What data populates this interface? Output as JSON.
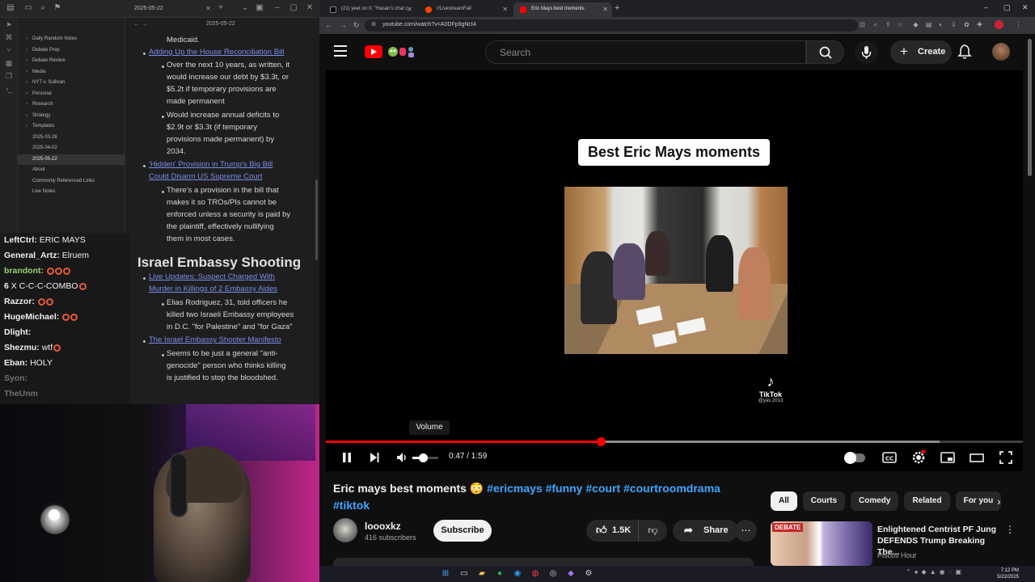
{
  "notes_app": {
    "tab_title": "2025-05-22",
    "note_title": "2025-05-22",
    "file_tree": [
      {
        "label": "Daily Random Notes",
        "folder": true
      },
      {
        "label": "Debate Prep",
        "folder": true
      },
      {
        "label": "Debate Review",
        "folder": true
      },
      {
        "label": "Media",
        "folder": true
      },
      {
        "label": "NYT v. Sullivan",
        "folder": true
      },
      {
        "label": "Personal",
        "folder": true
      },
      {
        "label": "Research",
        "folder": true
      },
      {
        "label": "Strategy",
        "folder": true
      },
      {
        "label": "Templates",
        "folder": true
      },
      {
        "label": "2025-03-26",
        "folder": false
      },
      {
        "label": "2025-04-02",
        "folder": false
      },
      {
        "label": "2025-05-22",
        "folder": false,
        "active": true
      },
      {
        "label": "About",
        "folder": false
      },
      {
        "label": "Commonly Referenced Links",
        "folder": false
      },
      {
        "label": "Live Notes",
        "folder": false
      }
    ],
    "body": {
      "medicaid": "Medicaid.",
      "link1": "Adding Up the House Reconciliation Bill",
      "b1": [
        "Over the next 10 years, as written, it",
        "would increase our debt by $3.3t, or",
        "$5.2t if temporary provisions are",
        "made permanent"
      ],
      "b2": [
        "Would increase annual deficits to",
        "$2.9t or $3.3t (if temporary",
        "provisions made permanent) by",
        "2034."
      ],
      "link2": [
        "'Hidden' Provision in Trump's Big Bill",
        "Could Disarm US Supreme Court"
      ],
      "b3": [
        "There's a provision in the bill that",
        "makes it so TROs/PIs cannot be",
        "enforced unless a security is paid by",
        "the plaintiff, effectively nullifying",
        "them in most cases."
      ],
      "heading": "Israel Embassy Shooting",
      "link3": [
        "Live Updates: Suspect Charged With",
        "Murder in Killings of 2 Embassy Aides"
      ],
      "b4": [
        "Elias Rodriguez, 31, told officers he",
        "killed two Israeli Embassy employees",
        "in D.C. \"for Palestine\" and \"for Gaza\""
      ],
      "link4": "The Israel Embassy Shooter Manifesto",
      "b5": [
        "Seems to be just a general \"anti-",
        "genocide\" person who thinks killing",
        "is justified to stop the bloodshed."
      ]
    }
  },
  "chat": [
    {
      "user": "LeftCtrl:",
      "msg": "ERIC MAYS",
      "color": "#f0f0f0"
    },
    {
      "user": "General_Artz:",
      "msg": "Elruem",
      "color": "#f0f0f0"
    },
    {
      "user": "brandont:",
      "msg": "",
      "color": "#9ad16a",
      "emotes": 3
    },
    {
      "user": "6",
      "msg": "X C-C-C-COMBO",
      "color": "#f0f0f0",
      "emotes": 1
    },
    {
      "user": "Razzor:",
      "msg": "",
      "color": "#f0f0f0",
      "emotes": 2
    },
    {
      "user": "HugeMichael:",
      "msg": "",
      "color": "#f0f0f0",
      "emotes": 2
    },
    {
      "user": "Dlight:",
      "msg": "",
      "color": "#f0f0f0"
    },
    {
      "user": "Shezmu:",
      "msg": "wtf",
      "color": "#f0f0f0",
      "emotes": 1
    },
    {
      "user": "Eban:",
      "msg": "HOLY",
      "color": "#f0f0f0"
    },
    {
      "user": "Syon:",
      "msg": "",
      "color": "#f0f0f0",
      "fade": true
    },
    {
      "user": "TheUnm",
      "msg": "",
      "color": "#f0f0f0",
      "fade": true
    }
  ],
  "browser": {
    "tabs": [
      {
        "title": "(21) yeet on X: \"Hasan's chat c",
        "fav": "#fff",
        "active": false
      },
      {
        "title": "r/LivestreamFail",
        "fav": "#ff4500",
        "active": false
      },
      {
        "title": "Eric Mays best moments",
        "fav": "#ff0000",
        "active": true
      }
    ],
    "url": "youtube.com/watch?v=A0DFp9gNcI4"
  },
  "youtube": {
    "search_placeholder": "Search",
    "create_label": "Create",
    "video": {
      "overlay_title": "Best Eric Mays moments",
      "watermark": "TikTok",
      "watermark_handle": "@yas.2013",
      "tooltip": "Volume",
      "current_time": "0:47",
      "duration": "1:59",
      "time_readout": "0:47 / 1:59",
      "progress": 0.395,
      "buffered": 0.88,
      "volume": 0.4
    },
    "title_main": "Eric mays best moments 😳",
    "title_tags": "#ericmays #funny #court #courtroomdrama #tiktok",
    "channel": {
      "name": "loooxkz",
      "subs": "416 subscribers"
    },
    "subscribe_label": "Subscribe",
    "likes": "1.5K",
    "share_label": "Share",
    "chips": [
      {
        "label": "All",
        "active": true
      },
      {
        "label": "Courts",
        "active": false
      },
      {
        "label": "Comedy",
        "active": false
      },
      {
        "label": "Related",
        "active": false
      },
      {
        "label": "For you",
        "active": false
      }
    ],
    "recommended": {
      "badge": "DEBATE",
      "title": "Enlightened Centrist PF Jung DEFENDS Trump Breaking The...",
      "channel": "Piscos Hour"
    }
  },
  "taskbar": {
    "time": "7:12 PM",
    "date": "5/22/2025"
  }
}
